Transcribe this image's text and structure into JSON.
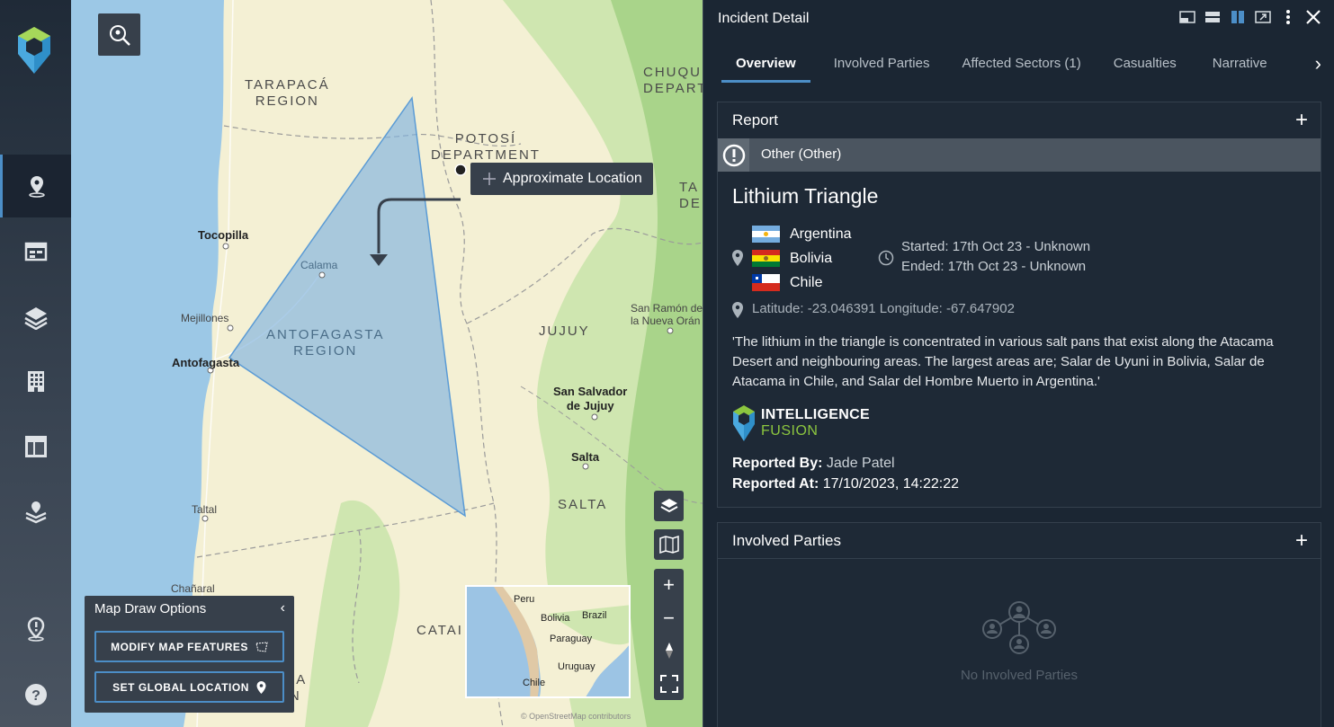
{
  "sidebar": {
    "items": [
      {
        "icon": "map-pin-icon",
        "active": true
      },
      {
        "icon": "calendar-icon",
        "active": false
      },
      {
        "icon": "layers-icon",
        "active": false
      },
      {
        "icon": "building-icon",
        "active": false
      },
      {
        "icon": "layout-icon",
        "active": false
      },
      {
        "icon": "stacked-pin-icon",
        "active": false
      },
      {
        "icon": "location-alert-icon",
        "active": false
      },
      {
        "icon": "help-icon",
        "active": false
      }
    ]
  },
  "map": {
    "labels": {
      "tarapaca": "TARAPACÁ\nREGION",
      "potosi": "POTOSÍ\nDEPARTMENT",
      "chuqui": "CHUQU\nDEPART",
      "ta": "TA\nDEPAR",
      "tocopilla": "Tocopilla",
      "calama": "Calama",
      "mejillones": "Mejillones",
      "antofagasta_region": "ANTOFAGASTA\nREGION",
      "antofagasta": "Antofagasta",
      "jujuy": "JUJUY",
      "san_ramon": "San Ramón de\nla Nueva Orán",
      "san_salvador": "San Salvador\nde Jujuy",
      "salta_city": "Salta",
      "salta_region": "SALTA",
      "taltal": "Taltal",
      "chanaral": "Chañaral",
      "catamarca": "CATAI",
      "atacama": "ATACAMA\nREGION",
      "attribution": "© OpenStreetMap contributors"
    },
    "tooltip": "Approximate Location",
    "draw_options": {
      "title": "Map Draw Options",
      "modify_label": "MODIFY MAP FEATURES",
      "global_label": "SET GLOBAL LOCATION"
    },
    "minimap": {
      "peru": "Peru",
      "bolivia": "Bolivia",
      "brazil": "Brazil",
      "paraguay": "Paraguay",
      "uruguay": "Uruguay",
      "chile": "Chile"
    }
  },
  "panel": {
    "title": "Incident Detail",
    "tabs": [
      "Overview",
      "Involved Parties",
      "Affected Sectors (1)",
      "Casualties",
      "Narrative"
    ],
    "report": {
      "heading": "Report",
      "category": "Other (Other)",
      "title": "Lithium Triangle",
      "countries": [
        "Argentina",
        "Bolivia",
        "Chile"
      ],
      "started": "Started: 17th Oct 23 - Unknown",
      "ended": "Ended: 17th Oct 23 - Unknown",
      "latlon": "Latitude: -23.046391 Longitude: -67.647902",
      "description": "'The lithium in the triangle is concentrated in various salt pans that exist along the Atacama Desert and neighbouring areas. The largest areas are; Salar de Uyuni in Bolivia, Salar de Atacama in Chile, and Salar del Hombre Muerto in Argentina.'",
      "brand_line1": "INTELLIGENCE",
      "brand_line2": "FUSION",
      "reported_by_label": "Reported By:",
      "reported_by": "Jade Patel",
      "reported_at_label": "Reported At:",
      "reported_at": "17/10/2023, 14:22:22"
    },
    "involved": {
      "heading": "Involved Parties",
      "empty": "No Involved Parties"
    }
  },
  "colors": {
    "accent": "#4c8ec7",
    "brand_green": "#8cc63f",
    "polygon": "#7fb2e0"
  }
}
